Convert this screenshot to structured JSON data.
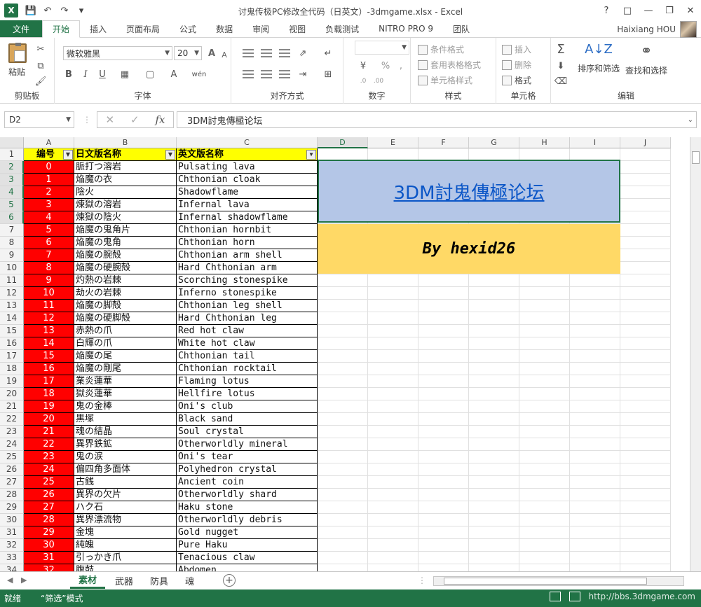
{
  "titlebar": {
    "logo": "X",
    "title": "讨鬼传极PC修改全代码（日英文）-3dmgame.xlsx - Excel",
    "qat": [
      "save-icon",
      "undo-icon",
      "redo-icon",
      "customize-icon"
    ],
    "win_ctrls": [
      "?",
      "□",
      "—",
      "❐",
      "✕"
    ]
  },
  "ribbon_tabs": {
    "file": "文件",
    "tabs": [
      "开始",
      "插入",
      "页面布局",
      "公式",
      "数据",
      "审阅",
      "视图",
      "负载测试",
      "NITRO PRO 9",
      "团队"
    ],
    "active": "开始",
    "user": "Haixiang HOU"
  },
  "ribbon": {
    "clipboard": {
      "label": "剪贴板",
      "paste": "粘贴"
    },
    "font": {
      "label": "字体",
      "name": "微软雅黑",
      "size": "20"
    },
    "align": {
      "label": "对齐方式"
    },
    "number": {
      "label": "数字",
      "percent": "%"
    },
    "styles": {
      "label": "样式",
      "cond": "条件格式",
      "table": "套用表格格式",
      "cell": "单元格样式"
    },
    "cells": {
      "label": "单元格",
      "insert": "插入",
      "delete": "删除",
      "format": "格式"
    },
    "edit": {
      "label": "编辑",
      "sort": "排序和筛选",
      "find": "查找和选择"
    }
  },
  "formula_bar": {
    "namebox": "D2",
    "fx": "fx",
    "content": "3DM討鬼傳極论坛"
  },
  "columns": [
    "A",
    "B",
    "C",
    "D",
    "E",
    "F",
    "G",
    "H",
    "I",
    "J"
  ],
  "selected_column": "D",
  "header_row": {
    "a": "编号",
    "b": "日文版名称",
    "c": "英文版名称"
  },
  "rows": [
    {
      "n": "2",
      "a": "0",
      "b": "脈打つ溶岩",
      "c": "Pulsating lava"
    },
    {
      "n": "3",
      "a": "1",
      "b": "焔魔の衣",
      "c": "Chthonian cloak"
    },
    {
      "n": "4",
      "a": "2",
      "b": "陰火",
      "c": "Shadowflame"
    },
    {
      "n": "5",
      "a": "3",
      "b": "煉獄の溶岩",
      "c": "Infernal lava"
    },
    {
      "n": "6",
      "a": "4",
      "b": "煉獄の陰火",
      "c": "Infernal shadowflame"
    },
    {
      "n": "7",
      "a": "5",
      "b": "焔魔の鬼角片",
      "c": "Chthonian hornbit"
    },
    {
      "n": "8",
      "a": "6",
      "b": "焔魔の鬼角",
      "c": "Chthonian horn"
    },
    {
      "n": "9",
      "a": "7",
      "b": "焔魔の腕殻",
      "c": "Chthonian arm shell"
    },
    {
      "n": "10",
      "a": "8",
      "b": "焔魔の硬腕殻",
      "c": "Hard Chthonian arm"
    },
    {
      "n": "11",
      "a": "9",
      "b": "灼熱の岩棘",
      "c": "Scorching stonespike"
    },
    {
      "n": "12",
      "a": "10",
      "b": "劫火の岩棘",
      "c": "Inferno stonespike"
    },
    {
      "n": "13",
      "a": "11",
      "b": "焔魔の脚殻",
      "c": "Chthonian leg shell"
    },
    {
      "n": "14",
      "a": "12",
      "b": "焔魔の硬脚殻",
      "c": "Hard Chthonian leg"
    },
    {
      "n": "15",
      "a": "13",
      "b": "赤熱の爪",
      "c": "Red hot claw"
    },
    {
      "n": "16",
      "a": "14",
      "b": "白輝の爪",
      "c": "White hot claw"
    },
    {
      "n": "17",
      "a": "15",
      "b": "焔魔の尾",
      "c": "Chthonian tail"
    },
    {
      "n": "18",
      "a": "16",
      "b": "焔魔の剛尾",
      "c": "Chthonian rocktail"
    },
    {
      "n": "19",
      "a": "17",
      "b": "業炎蓮華",
      "c": "Flaming lotus"
    },
    {
      "n": "20",
      "a": "18",
      "b": "獄炎蓮華",
      "c": "Hellfire lotus"
    },
    {
      "n": "21",
      "a": "19",
      "b": "鬼の金棒",
      "c": "Oni's club"
    },
    {
      "n": "22",
      "a": "20",
      "b": "黒塚",
      "c": "Black sand"
    },
    {
      "n": "23",
      "a": "21",
      "b": "魂の結晶",
      "c": "Soul crystal"
    },
    {
      "n": "24",
      "a": "22",
      "b": "異界鉄鉱",
      "c": "Otherworldly mineral"
    },
    {
      "n": "25",
      "a": "23",
      "b": "鬼の涙",
      "c": "Oni's tear"
    },
    {
      "n": "26",
      "a": "24",
      "b": "偏四角多面体",
      "c": "Polyhedron crystal"
    },
    {
      "n": "27",
      "a": "25",
      "b": "古銭",
      "c": "Ancient coin"
    },
    {
      "n": "28",
      "a": "26",
      "b": "異界の欠片",
      "c": "Otherworldly shard"
    },
    {
      "n": "29",
      "a": "27",
      "b": "ハク石",
      "c": "Haku stone"
    },
    {
      "n": "30",
      "a": "28",
      "b": "異界漂流物",
      "c": "Otherworldly debris"
    },
    {
      "n": "31",
      "a": "29",
      "b": "金塊",
      "c": "Gold nugget"
    },
    {
      "n": "32",
      "a": "30",
      "b": "純魄",
      "c": "Pure Haku"
    },
    {
      "n": "33",
      "a": "31",
      "b": "引っかき爪",
      "c": "Tenacious claw"
    },
    {
      "n": "34",
      "a": "32",
      "b": "腹鼓",
      "c": "Abdomen"
    }
  ],
  "banner": {
    "link": "3DM討鬼傳極论坛",
    "author": "By hexid26"
  },
  "sheets": [
    "素材",
    "武器",
    "防具",
    "魂"
  ],
  "active_sheet": "素材",
  "status": {
    "ready": "就绪",
    "mode": "“筛选”模式",
    "watermark": "http://bbs.3dmgame.com"
  },
  "colors": {
    "excel_green": "#217346",
    "id_red": "#ff0000",
    "header_yellow": "#ffff00",
    "banner_blue": "#b4c6e7",
    "banner_gold": "#ffd966"
  }
}
